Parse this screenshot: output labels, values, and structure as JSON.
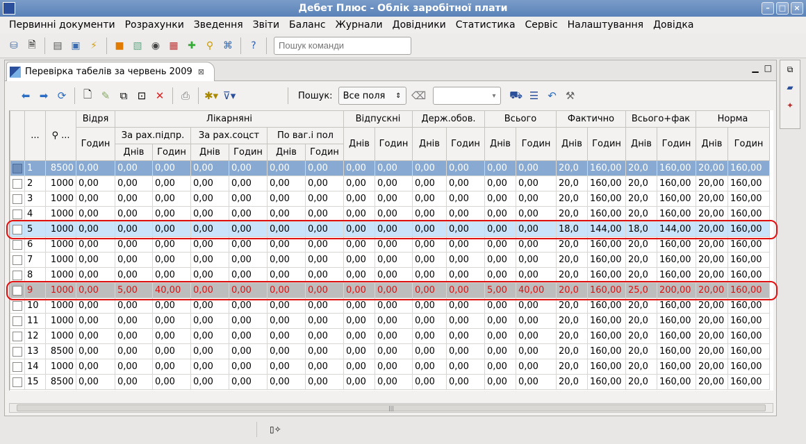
{
  "window": {
    "title": "Дебет Плюс - Облік заробітної плати"
  },
  "menu": [
    "Первинні документи",
    "Розрахунки",
    "Зведення",
    "Звіти",
    "Баланс",
    "Журнали",
    "Довідники",
    "Статистика",
    "Сервіс",
    "Налаштування",
    "Довідка"
  ],
  "toolbar": {
    "search_placeholder": "Пошук команди"
  },
  "tab": {
    "title": "Перевірка табелів за червень 2009"
  },
  "search": {
    "label": "Пошук:",
    "field": "Все поля"
  },
  "headers": {
    "col_dots": "...",
    "col_pin": "...",
    "vidrya": "Відря",
    "likarniani": "Лікарняні",
    "za_pidpr": "За рах.підпр.",
    "za_sotsstr": "За рах.соцст",
    "po_vag": "По ваг.і пол",
    "vidpustki": "Відпускні",
    "derzh": "Держ.обов.",
    "vsogo": "Всього",
    "faktychno": "Фактично",
    "vsogo_fakt": "Всього+фак",
    "norma": "Норма",
    "dniv": "Днів",
    "godyn": "Годин"
  },
  "rows": [
    [
      "1",
      "8500",
      "0,00",
      "0,00",
      "0,00",
      "0,00",
      "0,00",
      "0,00",
      "0,00",
      "0,00",
      "0,00",
      "0,00",
      "0,00",
      "0,00",
      "0,00",
      "20,0",
      "160,00",
      "20,0",
      "160,00",
      "20,00",
      "160,00"
    ],
    [
      "2",
      "1000",
      "0,00",
      "0,00",
      "0,00",
      "0,00",
      "0,00",
      "0,00",
      "0,00",
      "0,00",
      "0,00",
      "0,00",
      "0,00",
      "0,00",
      "0,00",
      "20,0",
      "160,00",
      "20,0",
      "160,00",
      "20,00",
      "160,00"
    ],
    [
      "3",
      "1000",
      "0,00",
      "0,00",
      "0,00",
      "0,00",
      "0,00",
      "0,00",
      "0,00",
      "0,00",
      "0,00",
      "0,00",
      "0,00",
      "0,00",
      "0,00",
      "20,0",
      "160,00",
      "20,0",
      "160,00",
      "20,00",
      "160,00"
    ],
    [
      "4",
      "1000",
      "0,00",
      "0,00",
      "0,00",
      "0,00",
      "0,00",
      "0,00",
      "0,00",
      "0,00",
      "0,00",
      "0,00",
      "0,00",
      "0,00",
      "0,00",
      "20,0",
      "160,00",
      "20,0",
      "160,00",
      "20,00",
      "160,00"
    ],
    [
      "5",
      "1000",
      "0,00",
      "0,00",
      "0,00",
      "0,00",
      "0,00",
      "0,00",
      "0,00",
      "0,00",
      "0,00",
      "0,00",
      "0,00",
      "0,00",
      "0,00",
      "18,0",
      "144,00",
      "18,0",
      "144,00",
      "20,00",
      "160,00"
    ],
    [
      "6",
      "1000",
      "0,00",
      "0,00",
      "0,00",
      "0,00",
      "0,00",
      "0,00",
      "0,00",
      "0,00",
      "0,00",
      "0,00",
      "0,00",
      "0,00",
      "0,00",
      "20,0",
      "160,00",
      "20,0",
      "160,00",
      "20,00",
      "160,00"
    ],
    [
      "7",
      "1000",
      "0,00",
      "0,00",
      "0,00",
      "0,00",
      "0,00",
      "0,00",
      "0,00",
      "0,00",
      "0,00",
      "0,00",
      "0,00",
      "0,00",
      "0,00",
      "20,0",
      "160,00",
      "20,0",
      "160,00",
      "20,00",
      "160,00"
    ],
    [
      "8",
      "1000",
      "0,00",
      "0,00",
      "0,00",
      "0,00",
      "0,00",
      "0,00",
      "0,00",
      "0,00",
      "0,00",
      "0,00",
      "0,00",
      "0,00",
      "0,00",
      "20,0",
      "160,00",
      "20,0",
      "160,00",
      "20,00",
      "160,00"
    ],
    [
      "9",
      "1000",
      "0,00",
      "5,00",
      "40,00",
      "0,00",
      "0,00",
      "0,00",
      "0,00",
      "0,00",
      "0,00",
      "0,00",
      "0,00",
      "5,00",
      "40,00",
      "20,0",
      "160,00",
      "25,0",
      "200,00",
      "20,00",
      "160,00"
    ],
    [
      "10",
      "1000",
      "0,00",
      "0,00",
      "0,00",
      "0,00",
      "0,00",
      "0,00",
      "0,00",
      "0,00",
      "0,00",
      "0,00",
      "0,00",
      "0,00",
      "0,00",
      "20,0",
      "160,00",
      "20,0",
      "160,00",
      "20,00",
      "160,00"
    ],
    [
      "11",
      "1000",
      "0,00",
      "0,00",
      "0,00",
      "0,00",
      "0,00",
      "0,00",
      "0,00",
      "0,00",
      "0,00",
      "0,00",
      "0,00",
      "0,00",
      "0,00",
      "20,0",
      "160,00",
      "20,0",
      "160,00",
      "20,00",
      "160,00"
    ],
    [
      "12",
      "1000",
      "0,00",
      "0,00",
      "0,00",
      "0,00",
      "0,00",
      "0,00",
      "0,00",
      "0,00",
      "0,00",
      "0,00",
      "0,00",
      "0,00",
      "0,00",
      "20,0",
      "160,00",
      "20,0",
      "160,00",
      "20,00",
      "160,00"
    ],
    [
      "13",
      "8500",
      "0,00",
      "0,00",
      "0,00",
      "0,00",
      "0,00",
      "0,00",
      "0,00",
      "0,00",
      "0,00",
      "0,00",
      "0,00",
      "0,00",
      "0,00",
      "20,0",
      "160,00",
      "20,0",
      "160,00",
      "20,00",
      "160,00"
    ],
    [
      "14",
      "1000",
      "0,00",
      "0,00",
      "0,00",
      "0,00",
      "0,00",
      "0,00",
      "0,00",
      "0,00",
      "0,00",
      "0,00",
      "0,00",
      "0,00",
      "0,00",
      "20,0",
      "160,00",
      "20,0",
      "160,00",
      "20,00",
      "160,00"
    ],
    [
      "15",
      "8500",
      "0,00",
      "0,00",
      "0,00",
      "0,00",
      "0,00",
      "0,00",
      "0,00",
      "0,00",
      "0,00",
      "0,00",
      "0,00",
      "0,00",
      "0,00",
      "20,0",
      "160,00",
      "20,0",
      "160,00",
      "20,00",
      "160,00"
    ]
  ],
  "row_styles": [
    "sel",
    "",
    "",
    "",
    "light",
    "",
    "",
    "",
    "gray",
    "",
    "",
    "",
    "",
    "",
    ""
  ],
  "colors": {
    "selected_row": "#88a9d2",
    "light_row": "#c9e3fb",
    "gray_row": "#bdbdbd",
    "highlight": "#e01010",
    "red_text": "#dd1111"
  }
}
